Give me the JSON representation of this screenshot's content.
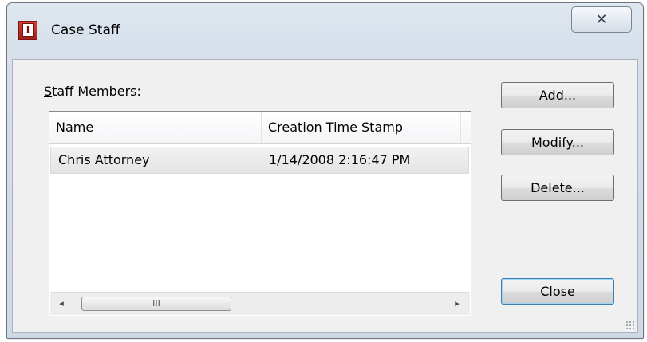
{
  "window": {
    "title": "Case Staff",
    "icon": "app-logo-icon",
    "close_glyph": "✕"
  },
  "staff": {
    "label_mnemonic": "S",
    "label_rest": "taff Members:",
    "columns": [
      "Name",
      "Creation Time Stamp"
    ],
    "rows": [
      {
        "name": "Chris Attorney",
        "created": "1/14/2008 2:16:47 PM"
      }
    ],
    "scrollbar": {
      "left_glyph": "◂",
      "right_glyph": "▸",
      "thumb_glyph": "III"
    }
  },
  "buttons": {
    "add": "Add...",
    "modify": "Modify...",
    "delete": "Delete...",
    "close": "Close"
  }
}
